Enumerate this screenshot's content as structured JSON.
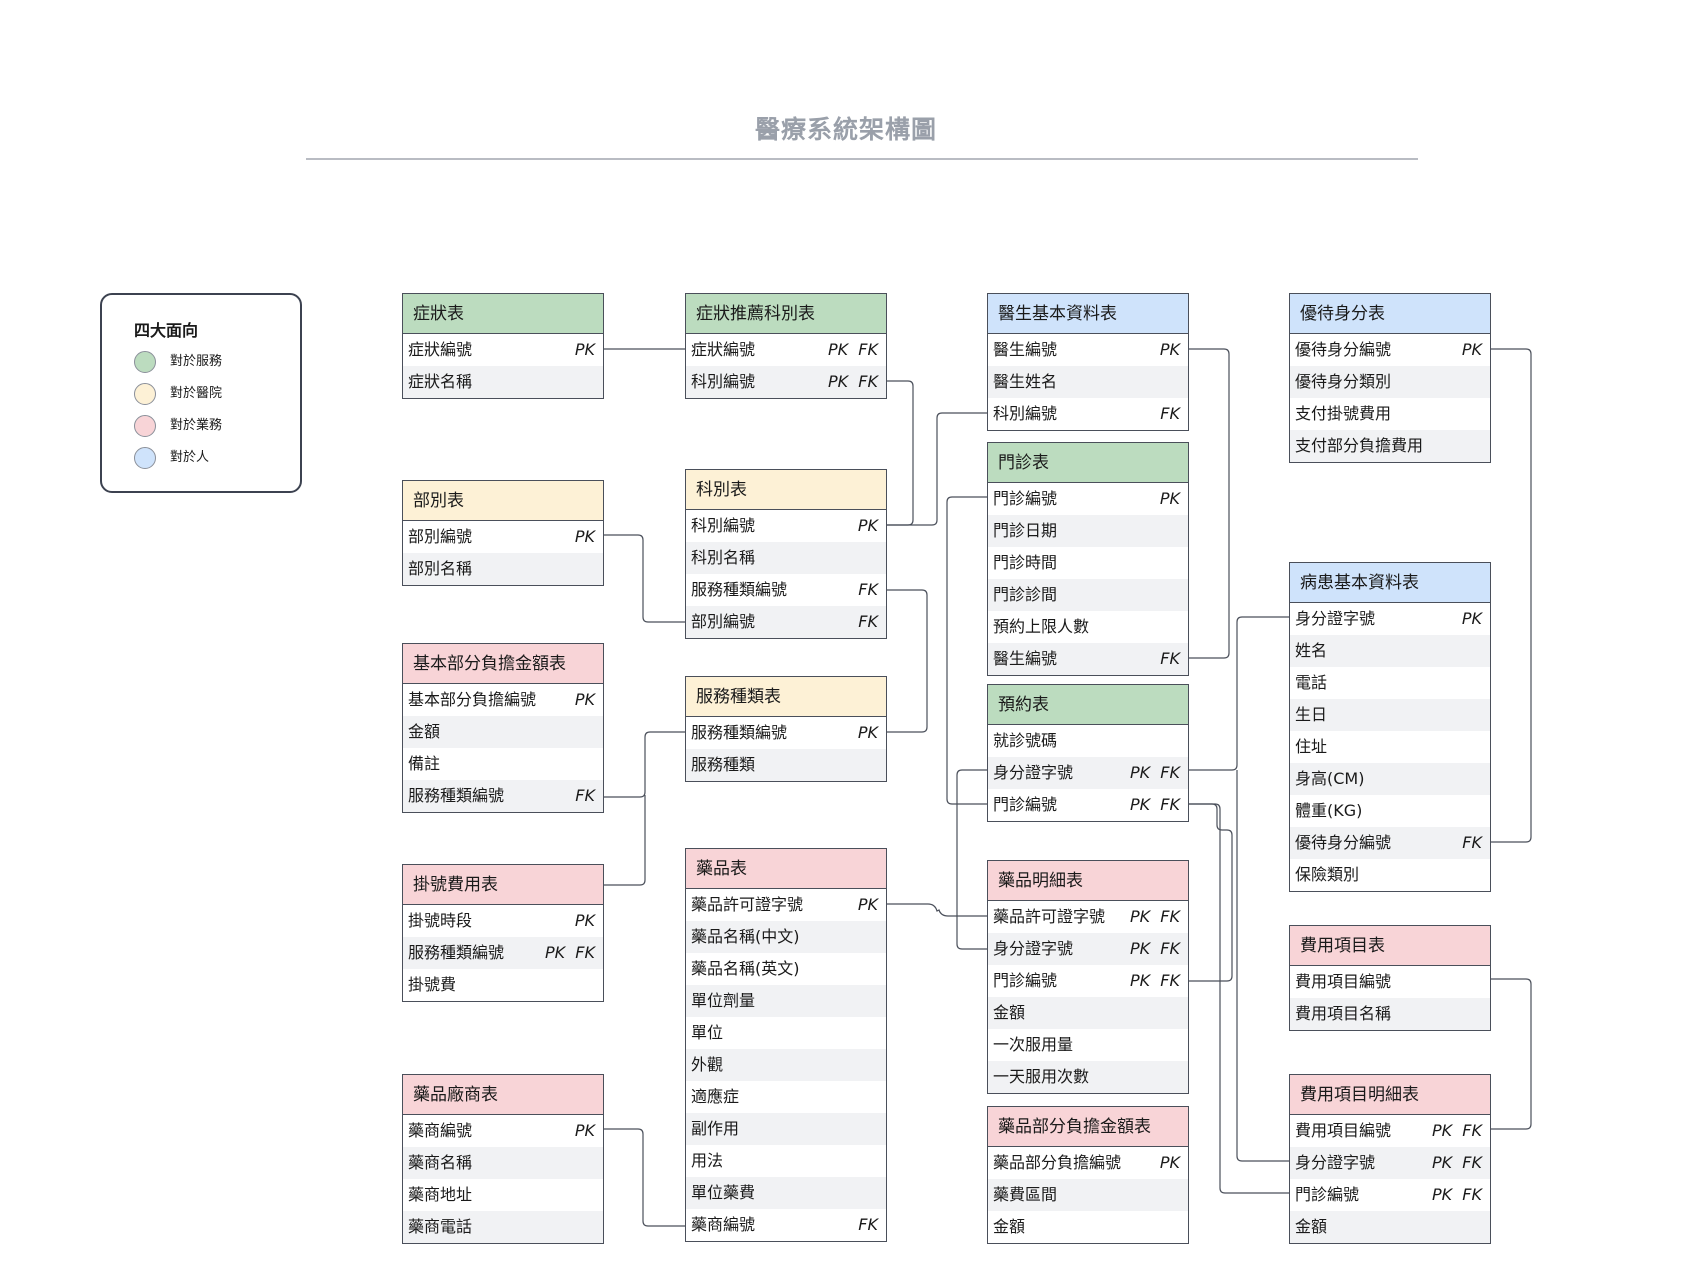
{
  "title": "醫療系統架構圖",
  "legend": {
    "title": "四大面向",
    "items": [
      {
        "label": "對於服務",
        "color": "#bcdcbf"
      },
      {
        "label": "對於醫院",
        "color": "#fdf1d6"
      },
      {
        "label": "對於業務",
        "color": "#f8d4d7"
      },
      {
        "label": "對於人",
        "color": "#cfe3fb"
      }
    ]
  },
  "tables": [
    {
      "id": "symptom",
      "name": "症狀表",
      "color": "#bcdcbf",
      "rows": [
        {
          "field": "症狀編號",
          "key": "PK"
        },
        {
          "field": "症狀名稱",
          "key": ""
        }
      ]
    },
    {
      "id": "symptom_dept",
      "name": "症狀推薦科別表",
      "color": "#bcdcbf",
      "rows": [
        {
          "field": "症狀編號",
          "key": "PK  FK"
        },
        {
          "field": "科別編號",
          "key": "PK  FK"
        }
      ]
    },
    {
      "id": "doctor",
      "name": "醫生基本資料表",
      "color": "#cfe3fb",
      "rows": [
        {
          "field": "醫生編號",
          "key": "PK"
        },
        {
          "field": "醫生姓名",
          "key": ""
        },
        {
          "field": "科別編號",
          "key": "FK"
        }
      ]
    },
    {
      "id": "discount",
      "name": "優待身分表",
      "color": "#cfe3fb",
      "rows": [
        {
          "field": "優待身分編號",
          "key": "PK"
        },
        {
          "field": "優待身分類別",
          "key": ""
        },
        {
          "field": "支付掛號費用",
          "key": ""
        },
        {
          "field": "支付部分負擔費用",
          "key": ""
        }
      ]
    },
    {
      "id": "division",
      "name": "部別表",
      "color": "#fdf1d6",
      "rows": [
        {
          "field": "部別編號",
          "key": "PK"
        },
        {
          "field": "部別名稱",
          "key": ""
        }
      ]
    },
    {
      "id": "dept",
      "name": "科別表",
      "color": "#fdf1d6",
      "rows": [
        {
          "field": "科別編號",
          "key": "PK"
        },
        {
          "field": "科別名稱",
          "key": ""
        },
        {
          "field": "服務種類編號",
          "key": "FK"
        },
        {
          "field": "部別編號",
          "key": "FK"
        }
      ]
    },
    {
      "id": "clinic",
      "name": "門診表",
      "color": "#bcdcbf",
      "rows": [
        {
          "field": "門診編號",
          "key": "PK"
        },
        {
          "field": "門診日期",
          "key": ""
        },
        {
          "field": "門診時間",
          "key": ""
        },
        {
          "field": "門診診間",
          "key": ""
        },
        {
          "field": "預約上限人數",
          "key": ""
        },
        {
          "field": "醫生編號",
          "key": "FK"
        }
      ]
    },
    {
      "id": "patient",
      "name": "病患基本資料表",
      "color": "#cfe3fb",
      "rows": [
        {
          "field": "身分證字號",
          "key": "PK"
        },
        {
          "field": "姓名",
          "key": ""
        },
        {
          "field": "電話",
          "key": ""
        },
        {
          "field": "生日",
          "key": ""
        },
        {
          "field": "住址",
          "key": ""
        },
        {
          "field": "身高(CM)",
          "key": ""
        },
        {
          "field": "體重(KG)",
          "key": ""
        },
        {
          "field": "優待身分編號",
          "key": "FK"
        },
        {
          "field": "保險類別",
          "key": ""
        }
      ]
    },
    {
      "id": "base_copay",
      "name": "基本部分負擔金額表",
      "color": "#f8d4d7",
      "rows": [
        {
          "field": "基本部分負擔編號",
          "key": "PK"
        },
        {
          "field": "金額",
          "key": ""
        },
        {
          "field": "備註",
          "key": ""
        },
        {
          "field": "服務種類編號",
          "key": "FK"
        }
      ]
    },
    {
      "id": "service",
      "name": "服務種類表",
      "color": "#fdf1d6",
      "rows": [
        {
          "field": "服務種類編號",
          "key": "PK"
        },
        {
          "field": "服務種類",
          "key": ""
        }
      ]
    },
    {
      "id": "appointment",
      "name": "預約表",
      "color": "#bcdcbf",
      "rows": [
        {
          "field": "就診號碼",
          "key": ""
        },
        {
          "field": "身分證字號",
          "key": "PK  FK"
        },
        {
          "field": "門診編號",
          "key": "PK  FK"
        }
      ]
    },
    {
      "id": "reg_fee",
      "name": "掛號費用表",
      "color": "#f8d4d7",
      "rows": [
        {
          "field": "掛號時段",
          "key": "PK"
        },
        {
          "field": "服務種類編號",
          "key": "PK  FK"
        },
        {
          "field": "掛號費",
          "key": ""
        }
      ]
    },
    {
      "id": "drug",
      "name": "藥品表",
      "color": "#f8d4d7",
      "rows": [
        {
          "field": "藥品許可證字號",
          "key": "PK"
        },
        {
          "field": "藥品名稱(中文)",
          "key": ""
        },
        {
          "field": "藥品名稱(英文)",
          "key": ""
        },
        {
          "field": "單位劑量",
          "key": ""
        },
        {
          "field": "單位",
          "key": ""
        },
        {
          "field": "外觀",
          "key": ""
        },
        {
          "field": "適應症",
          "key": ""
        },
        {
          "field": "副作用",
          "key": ""
        },
        {
          "field": "用法",
          "key": ""
        },
        {
          "field": "單位藥費",
          "key": ""
        },
        {
          "field": "藥商編號",
          "key": "FK"
        }
      ]
    },
    {
      "id": "drug_detail",
      "name": "藥品明細表",
      "color": "#f8d4d7",
      "rows": [
        {
          "field": "藥品許可證字號",
          "key": "PK  FK"
        },
        {
          "field": "身分證字號",
          "key": "PK  FK"
        },
        {
          "field": "門診編號",
          "key": "PK  FK"
        },
        {
          "field": "金額",
          "key": ""
        },
        {
          "field": "一次服用量",
          "key": ""
        },
        {
          "field": "一天服用次數",
          "key": ""
        }
      ]
    },
    {
      "id": "fee_item",
      "name": "費用項目表",
      "color": "#f8d4d7",
      "rows": [
        {
          "field": "費用項目編號",
          "key": ""
        },
        {
          "field": "費用項目名稱",
          "key": ""
        }
      ]
    },
    {
      "id": "vendor",
      "name": "藥品廠商表",
      "color": "#f8d4d7",
      "rows": [
        {
          "field": "藥商編號",
          "key": "PK"
        },
        {
          "field": "藥商名稱",
          "key": ""
        },
        {
          "field": "藥商地址",
          "key": ""
        },
        {
          "field": "藥商電話",
          "key": ""
        }
      ]
    },
    {
      "id": "drug_copay",
      "name": "藥品部分負擔金額表",
      "color": "#f8d4d7",
      "rows": [
        {
          "field": "藥品部分負擔編號",
          "key": "PK"
        },
        {
          "field": "藥費區間",
          "key": ""
        },
        {
          "field": "金額",
          "key": ""
        }
      ]
    },
    {
      "id": "fee_detail",
      "name": "費用項目明細表",
      "color": "#f8d4d7",
      "rows": [
        {
          "field": "費用項目編號",
          "key": "PK  FK"
        },
        {
          "field": "身分證字號",
          "key": "PK  FK"
        },
        {
          "field": "門診編號",
          "key": "PK  FK"
        },
        {
          "field": "金額",
          "key": ""
        }
      ]
    }
  ]
}
